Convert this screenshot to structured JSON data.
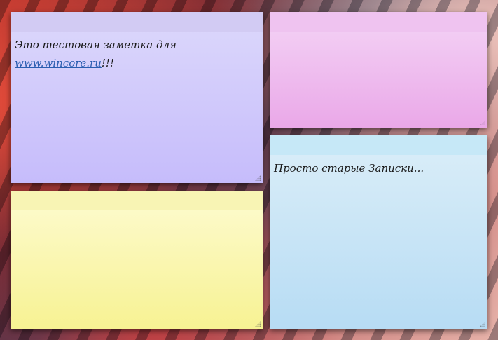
{
  "notes": [
    {
      "id": "n1",
      "color": "purple",
      "text_before_link": "Это тестовая заметка для ",
      "link_text": "www.wincore.ru",
      "text_after_link": "!!!"
    },
    {
      "id": "n2",
      "color": "pink",
      "text": ""
    },
    {
      "id": "n3",
      "color": "yellow",
      "text": ""
    },
    {
      "id": "n4",
      "color": "blue",
      "text": "Просто старые Записки..."
    }
  ],
  "colors": {
    "link": "#2a5db0",
    "purple": "#c6bcfb",
    "pink": "#eaa8e8",
    "yellow": "#f7f292",
    "blue": "#b7dcf4"
  }
}
